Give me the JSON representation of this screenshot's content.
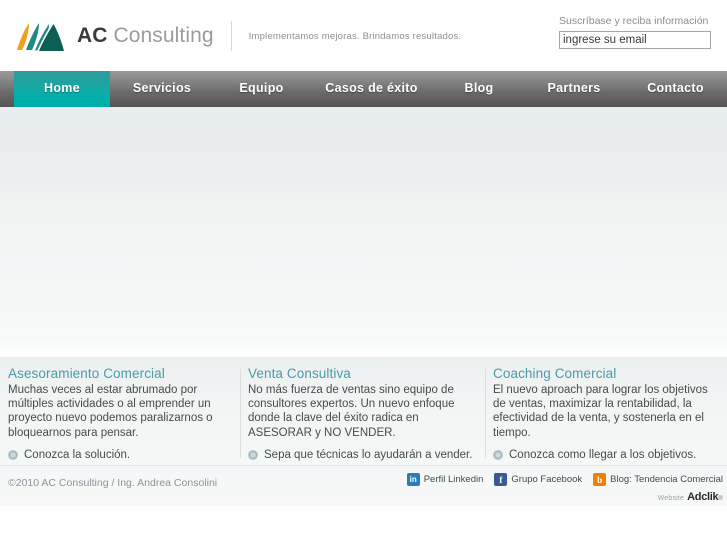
{
  "header": {
    "logo": {
      "icon_name": "mountain-logo-icon",
      "colors": {
        "peak_left": "#f0a01e",
        "peak_mid": "#1f8a82",
        "peak_right": "#0d5f56"
      },
      "text_bold": "AC",
      "text_light": "Consulting"
    },
    "tagline": "Implementamos mejoras. Brindamos resultados.",
    "newsletter": {
      "label": "Suscríbase y reciba información",
      "value": "ingrese su email",
      "placeholder": "ingrese su email"
    }
  },
  "nav": {
    "active_index": 0,
    "accent_color": "#00b0ab",
    "items": [
      {
        "label": "Home"
      },
      {
        "label": "Servicios"
      },
      {
        "label": "Equipo"
      },
      {
        "label": "Casos de éxito"
      },
      {
        "label": "Blog"
      },
      {
        "label": "Partners"
      },
      {
        "label": "Contacto"
      }
    ]
  },
  "banner": {
    "alt": ""
  },
  "columns": [
    {
      "title": "Asesoramiento Comercial",
      "body": "Muchas veces al estar abrumado por múltiples actividades o al emprender un proyecto nuevo podemos paralizarnos o bloquearnos para pensar.",
      "link": "Conozca la solución."
    },
    {
      "title": "Venta Consultiva",
      "body": "No más fuerza de ventas sino equipo de consultores expertos. Un nuevo enfoque donde la clave del éxito radica en ASESORAR y NO VENDER.",
      "link": "Sepa que técnicas lo ayudarán a vender."
    },
    {
      "title": "Coaching Comercial",
      "body": "El nuevo aproach para lograr los objetivos de ventas, maximizar la rentabilidad, la efectividad de la venta, y sostenerla en el tiempo.",
      "link": "Conozca como llegar a los objetivos."
    }
  ],
  "footer": {
    "copyright": "©2010 AC Consulting / Ing. Andrea Consolini",
    "social": [
      {
        "icon_name": "linkedin-icon",
        "glyph": "in",
        "label": "Perfil Linkedin"
      },
      {
        "icon_name": "facebook-icon",
        "glyph": "f",
        "label": "Grupo Facebook"
      },
      {
        "icon_name": "blogger-icon",
        "glyph": "b",
        "label": "Blog: Tendencia Comercial"
      }
    ],
    "credit": {
      "prefix": "Website",
      "brand": "Adclik",
      "tm": "®"
    }
  }
}
